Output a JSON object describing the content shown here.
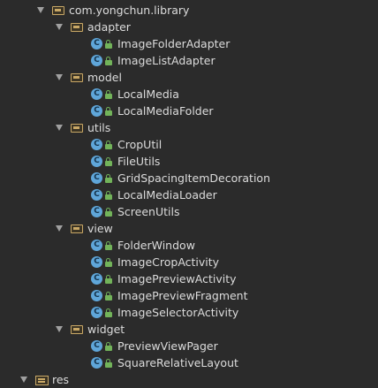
{
  "tree": {
    "library_package": "com.yongchun.library",
    "packages": {
      "adapter": {
        "label": "adapter",
        "classes": [
          "ImageFolderAdapter",
          "ImageListAdapter"
        ]
      },
      "model": {
        "label": "model",
        "classes": [
          "LocalMedia",
          "LocalMediaFolder"
        ]
      },
      "utils": {
        "label": "utils",
        "classes": [
          "CropUtil",
          "FileUtils",
          "GridSpacingItemDecoration",
          "LocalMediaLoader",
          "ScreenUtils"
        ]
      },
      "view": {
        "label": "view",
        "classes": [
          "FolderWindow",
          "ImageCropActivity",
          "ImagePreviewActivity",
          "ImagePreviewFragment",
          "ImageSelectorActivity"
        ]
      },
      "widget": {
        "label": "widget",
        "classes": [
          "PreviewViewPager",
          "SquareRelativeLayout"
        ]
      }
    },
    "res_folder": "res",
    "class_icon_letter": "C"
  },
  "colors": {
    "background": "#2b2b2b",
    "text": "#dcdcdc",
    "folder": "#c9a866",
    "class_icon": "#5fa6d9",
    "lock": "#72b35a",
    "arrow": "#a0a0a0"
  },
  "icons": {
    "expand": "triangle-down-icon",
    "package": "package-folder-icon",
    "class": "class-c-icon",
    "access": "lock-icon",
    "resources": "resources-folder-icon"
  }
}
